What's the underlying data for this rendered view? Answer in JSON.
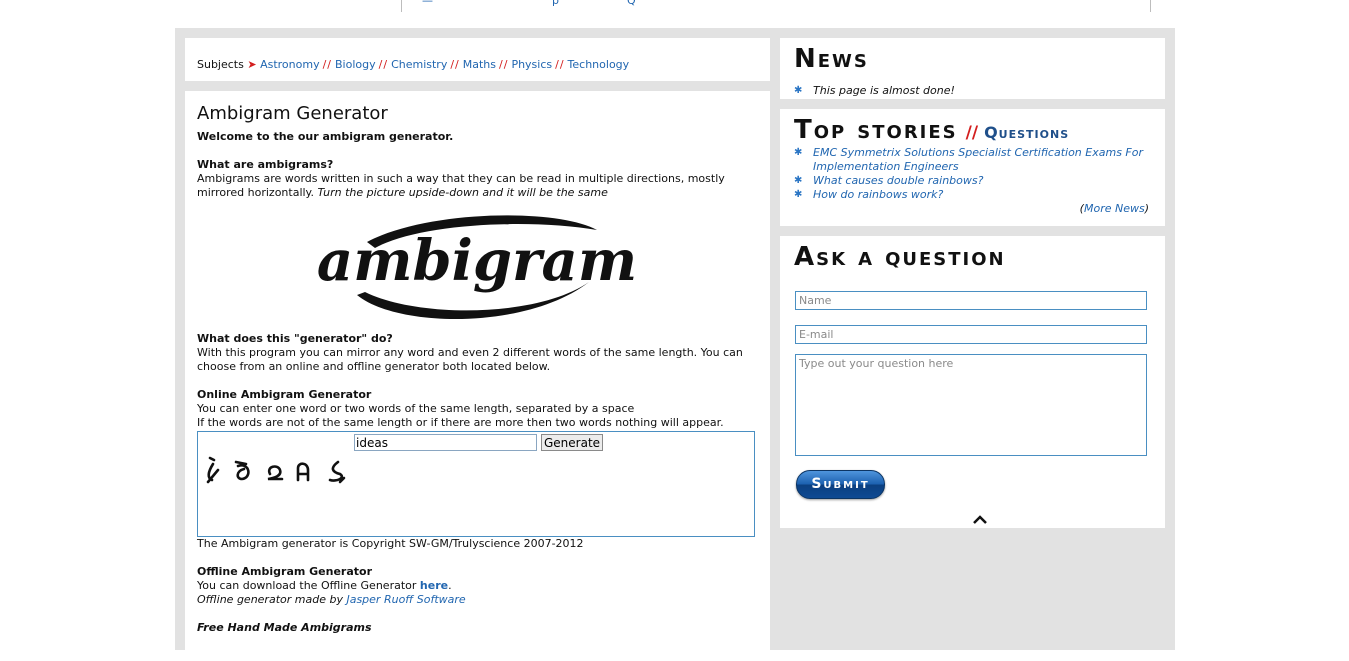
{
  "top_strip": {
    "fragment_1": "—",
    "fragment_2": "p",
    "fragment_3": "Q"
  },
  "subjects": {
    "label": "Subjects",
    "arrow": "➤",
    "separator": "//",
    "items": [
      "Astronomy",
      "Biology",
      "Chemistry",
      "Maths",
      "Physics",
      "Technology"
    ]
  },
  "main": {
    "title": "Ambigram Generator",
    "welcome": "Welcome to the our ambigram generator.",
    "q1": "What are ambigrams?",
    "a1_line1": "Ambigrams are words written in such a way that they can be read in multiple directions, mostly",
    "a1_line2_plain": "mirrored horizontally.",
    "a1_line2_italic": "Turn the picture upside-down and it will be the same",
    "logo_text": "ambigram",
    "q2": "What does this \"generator\" do?",
    "a2_line1": "With this program you can mirror any word and even 2 different words of the same length. You can",
    "a2_line2": "choose from an online and offline generator both located below.",
    "online_heading": "Online Ambigram Generator",
    "online_line1": "You can enter one word or two words of the same length, separated by a space",
    "online_line2": "If the words are not of the same length or if there are more then two words nothing will appear.",
    "generator": {
      "input_value": "ideas",
      "button_label": "Generate",
      "output_glyphs": [
        "i",
        "d",
        "e",
        "a",
        "s"
      ]
    },
    "copyright": "The Ambigram generator is Copyright SW-GM/Trulyscience 2007-2012",
    "offline_heading": "Offline Ambigram Generator",
    "offline_line1_plain": "You can download the Offline Generator",
    "offline_line1_link": "here",
    "offline_line1_end": ".",
    "offline_line2_plain": "Offline generator made by",
    "offline_line2_link": "Jasper Ruoff Software",
    "freehand_heading": "Free Hand Made Ambigrams"
  },
  "news": {
    "heading": "News",
    "items": [
      "This page is almost done!"
    ]
  },
  "top_stories": {
    "heading": "Top stories",
    "separator": "//",
    "tab_label": "Questions",
    "items": [
      "EMC Symmetrix Solutions Specialist Certification Exams For Implementation Engineers",
      "What causes double rainbows?",
      "How do rainbows work?"
    ],
    "more_open": "(",
    "more_link": "More News",
    "more_close": ")"
  },
  "ask": {
    "heading": "Ask a question",
    "name_placeholder": "Name",
    "email_placeholder": "E-mail",
    "question_placeholder": "Type out your question here",
    "submit_label": "Submit"
  },
  "colors": {
    "link": "#2166b0",
    "accent_red": "#d31e1e",
    "panel_bg": "#e2e2e2",
    "input_border": "#4a8fc2"
  }
}
